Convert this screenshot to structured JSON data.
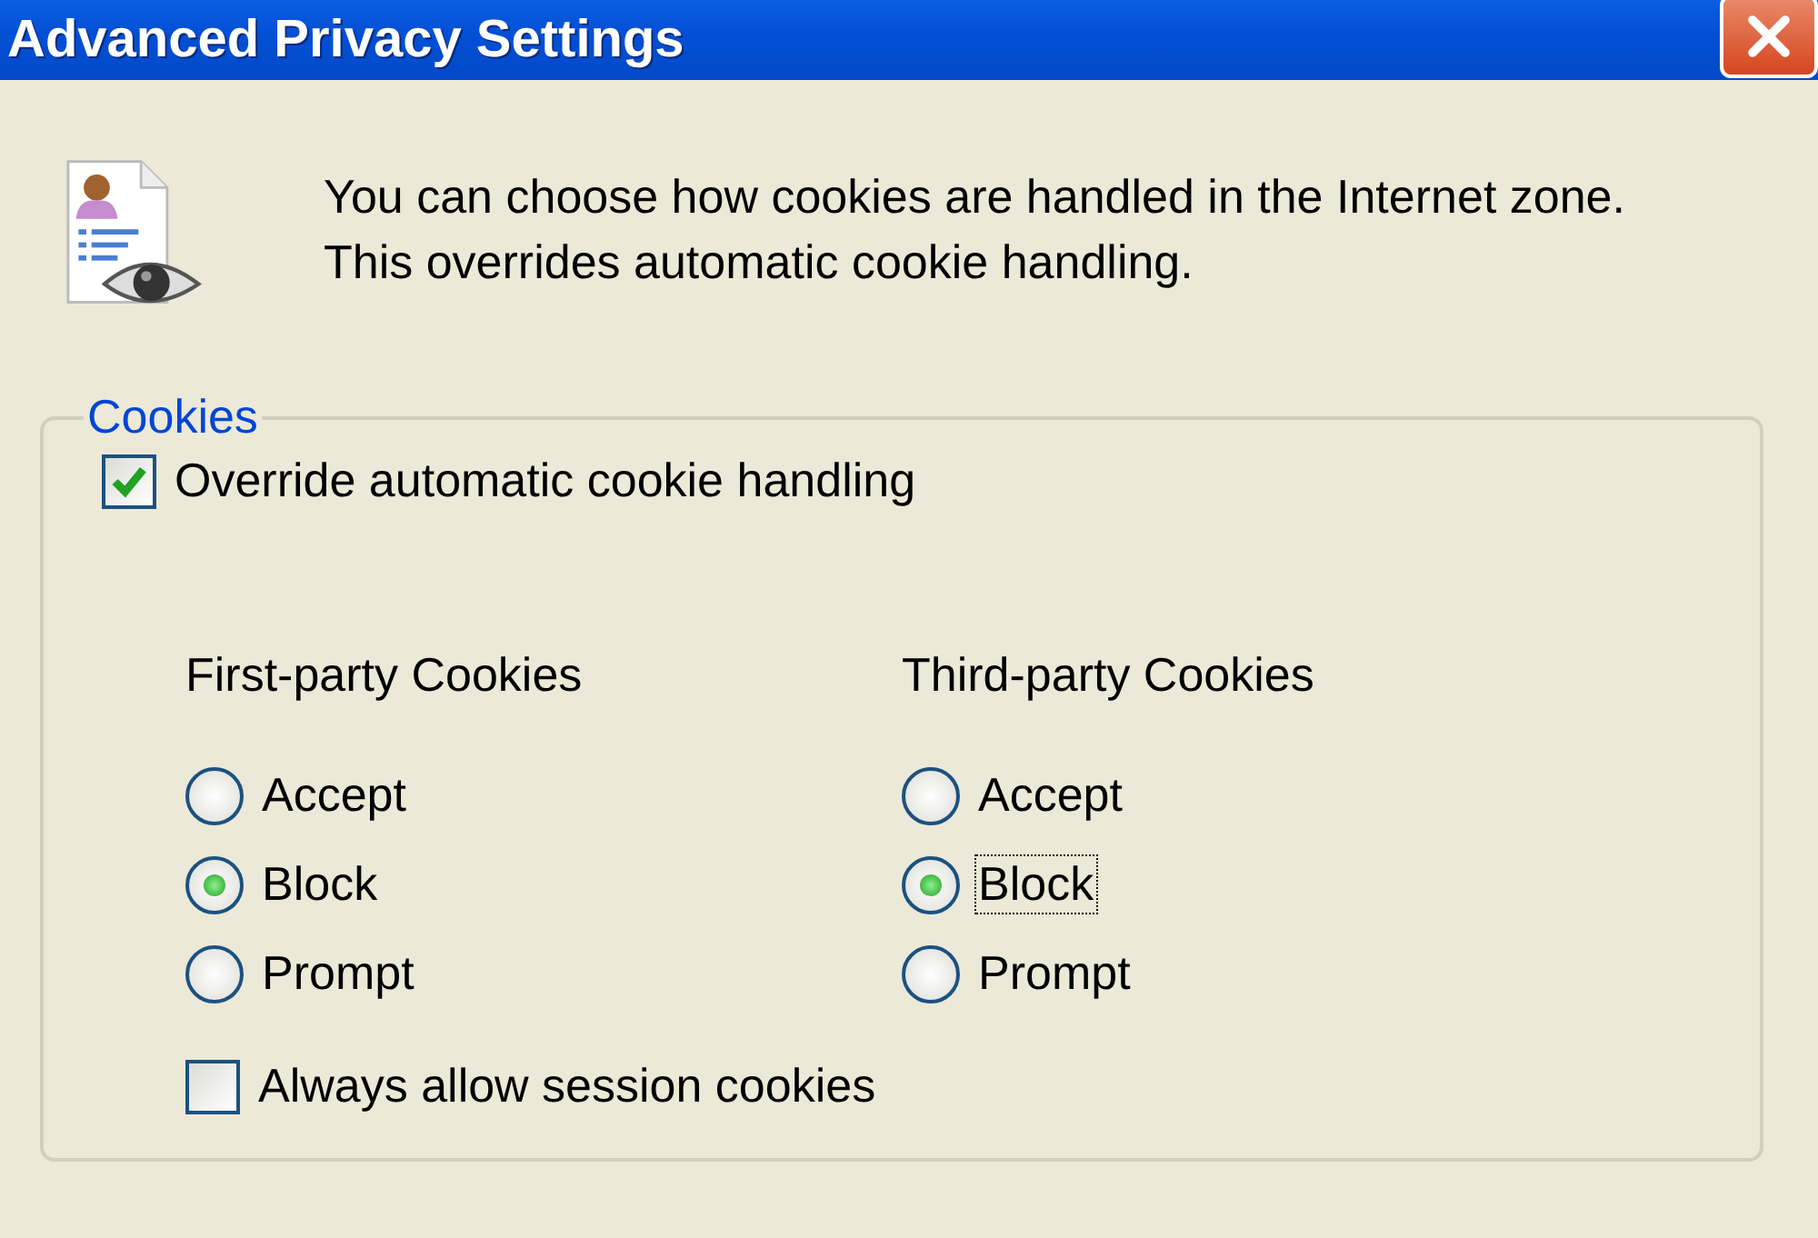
{
  "window": {
    "title": "Advanced Privacy Settings"
  },
  "intro": "You can choose how cookies are handled in the Internet zone.  This overrides automatic cookie handling.",
  "group": {
    "label": "Cookies",
    "override": {
      "label": "Override automatic cookie handling",
      "checked": true
    },
    "columns": [
      {
        "heading": "First-party Cookies",
        "options": [
          {
            "label": "Accept",
            "selected": false,
            "focused": false
          },
          {
            "label": "Block",
            "selected": true,
            "focused": false
          },
          {
            "label": "Prompt",
            "selected": false,
            "focused": false
          }
        ]
      },
      {
        "heading": "Third-party Cookies",
        "options": [
          {
            "label": "Accept",
            "selected": false,
            "focused": false
          },
          {
            "label": "Block",
            "selected": true,
            "focused": true
          },
          {
            "label": "Prompt",
            "selected": false,
            "focused": false
          }
        ]
      }
    ],
    "session": {
      "label": "Always allow session cookies",
      "checked": false
    }
  }
}
